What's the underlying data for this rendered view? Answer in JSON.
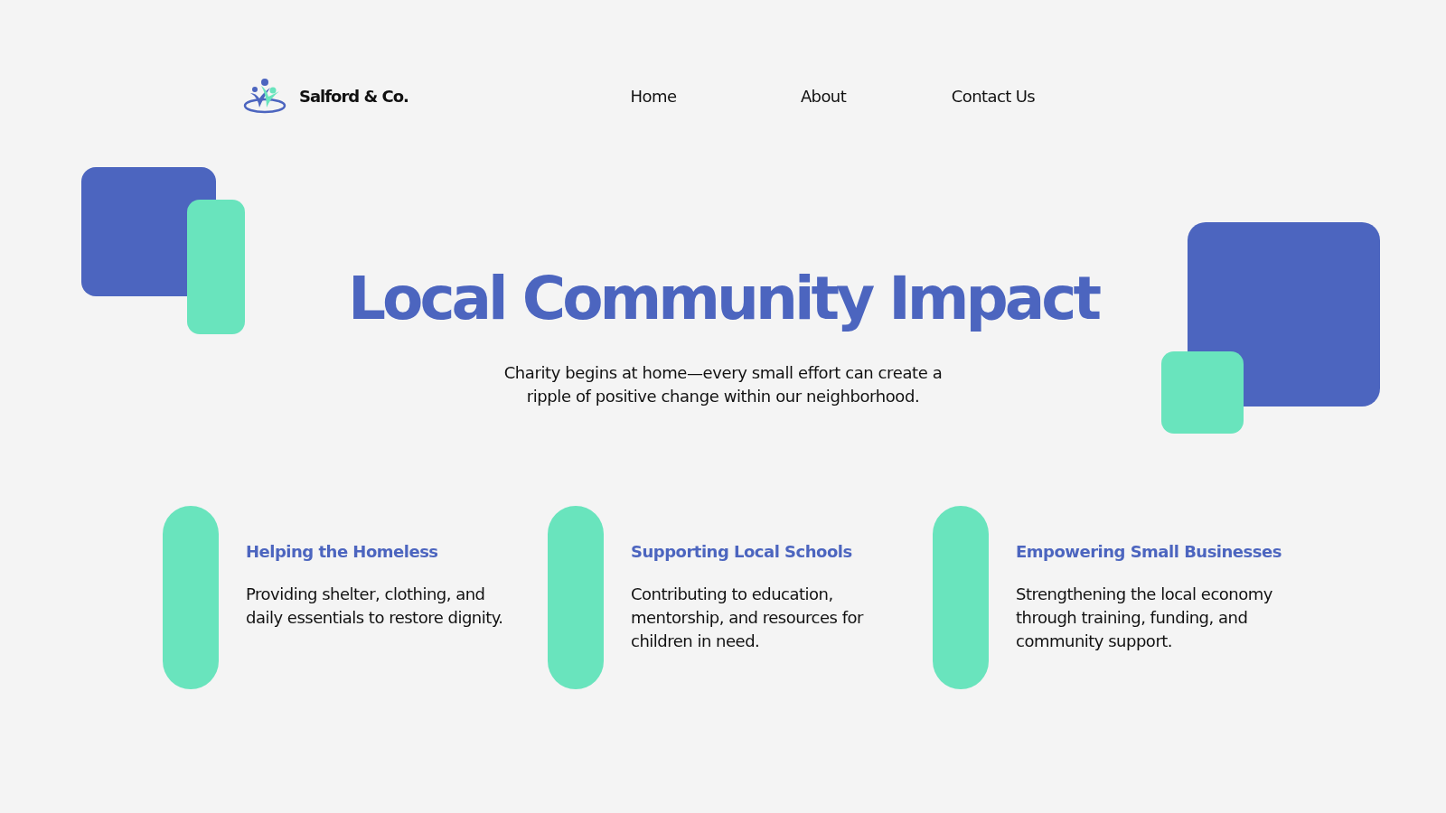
{
  "brand": {
    "name": "Salford & Co."
  },
  "nav": [
    {
      "label": "Home"
    },
    {
      "label": "About"
    },
    {
      "label": "Contact Us"
    }
  ],
  "hero": {
    "title": "Local Community Impact",
    "subtitle": "Charity begins at home—every small effort can create a ripple of positive change within our neighborhood."
  },
  "features": [
    {
      "title": "Helping the Homeless",
      "text": "Providing shelter, clothing, and daily essentials to restore dignity."
    },
    {
      "title": "Supporting Local Schools",
      "text": "Contributing to education, mentorship, and resources for children in need."
    },
    {
      "title": "Empowering Small Businesses",
      "text": "Strengthening the local economy through training, funding, and community support."
    }
  ]
}
